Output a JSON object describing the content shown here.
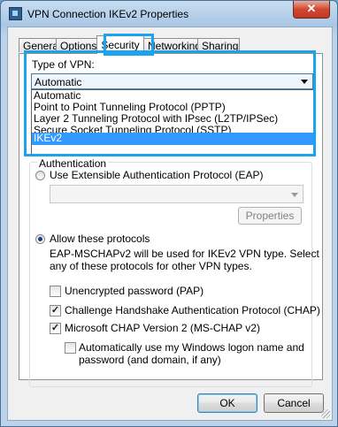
{
  "window": {
    "title": "VPN Connection IKEv2 Properties",
    "close_label": "✕"
  },
  "tabs": [
    {
      "label": "General"
    },
    {
      "label": "Options"
    },
    {
      "label": "Security"
    },
    {
      "label": "Networking"
    },
    {
      "label": "Sharing"
    }
  ],
  "vpn_type": {
    "label": "Type of VPN:",
    "selected": "Automatic",
    "options": [
      "Automatic",
      "Point to Point Tunneling Protocol (PPTP)",
      "Layer 2 Tunneling Protocol with IPsec (L2TP/IPSec)",
      "Secure Socket Tunneling Protocol (SSTP)",
      "IKEv2"
    ],
    "highlighted": "IKEv2"
  },
  "authentication": {
    "group_label": "Authentication",
    "eap_label": "Use Extensible Authentication Protocol (EAP)",
    "eap_selected": false,
    "properties_label": "Properties",
    "allow_label": "Allow these protocols",
    "allow_selected": true,
    "note_line1": "EAP-MSCHAPv2 will be used for IKEv2 VPN type. Select",
    "note_line2": "any of these protocols for other VPN types.",
    "pap_label": "Unencrypted password (PAP)",
    "pap_checked": false,
    "chap_label": "Challenge Handshake Authentication Protocol (CHAP)",
    "chap_checked": true,
    "mschap_label": "Microsoft CHAP Version 2 (MS-CHAP v2)",
    "mschap_checked": true,
    "auto_logon_line1": "Automatically use my Windows logon name and",
    "auto_logon_line2": "password (and domain, if any)",
    "auto_logon_checked": false
  },
  "footer": {
    "ok_label": "OK",
    "cancel_label": "Cancel"
  },
  "colors": {
    "highlight": "#1aa3ef",
    "selection": "#3399ff"
  }
}
